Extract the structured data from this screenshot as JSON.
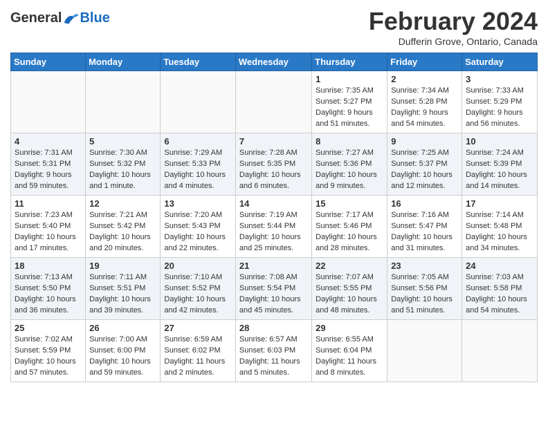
{
  "logo": {
    "general": "General",
    "blue": "Blue",
    "tagline": ""
  },
  "header": {
    "title": "February 2024",
    "subtitle": "Dufferin Grove, Ontario, Canada"
  },
  "days_of_week": [
    "Sunday",
    "Monday",
    "Tuesday",
    "Wednesday",
    "Thursday",
    "Friday",
    "Saturday"
  ],
  "weeks": [
    {
      "shaded": false,
      "days": [
        {
          "date": "",
          "info": ""
        },
        {
          "date": "",
          "info": ""
        },
        {
          "date": "",
          "info": ""
        },
        {
          "date": "",
          "info": ""
        },
        {
          "date": "1",
          "info": "Sunrise: 7:35 AM\nSunset: 5:27 PM\nDaylight: 9 hours and 51 minutes."
        },
        {
          "date": "2",
          "info": "Sunrise: 7:34 AM\nSunset: 5:28 PM\nDaylight: 9 hours and 54 minutes."
        },
        {
          "date": "3",
          "info": "Sunrise: 7:33 AM\nSunset: 5:29 PM\nDaylight: 9 hours and 56 minutes."
        }
      ]
    },
    {
      "shaded": true,
      "days": [
        {
          "date": "4",
          "info": "Sunrise: 7:31 AM\nSunset: 5:31 PM\nDaylight: 9 hours and 59 minutes."
        },
        {
          "date": "5",
          "info": "Sunrise: 7:30 AM\nSunset: 5:32 PM\nDaylight: 10 hours and 1 minute."
        },
        {
          "date": "6",
          "info": "Sunrise: 7:29 AM\nSunset: 5:33 PM\nDaylight: 10 hours and 4 minutes."
        },
        {
          "date": "7",
          "info": "Sunrise: 7:28 AM\nSunset: 5:35 PM\nDaylight: 10 hours and 6 minutes."
        },
        {
          "date": "8",
          "info": "Sunrise: 7:27 AM\nSunset: 5:36 PM\nDaylight: 10 hours and 9 minutes."
        },
        {
          "date": "9",
          "info": "Sunrise: 7:25 AM\nSunset: 5:37 PM\nDaylight: 10 hours and 12 minutes."
        },
        {
          "date": "10",
          "info": "Sunrise: 7:24 AM\nSunset: 5:39 PM\nDaylight: 10 hours and 14 minutes."
        }
      ]
    },
    {
      "shaded": false,
      "days": [
        {
          "date": "11",
          "info": "Sunrise: 7:23 AM\nSunset: 5:40 PM\nDaylight: 10 hours and 17 minutes."
        },
        {
          "date": "12",
          "info": "Sunrise: 7:21 AM\nSunset: 5:42 PM\nDaylight: 10 hours and 20 minutes."
        },
        {
          "date": "13",
          "info": "Sunrise: 7:20 AM\nSunset: 5:43 PM\nDaylight: 10 hours and 22 minutes."
        },
        {
          "date": "14",
          "info": "Sunrise: 7:19 AM\nSunset: 5:44 PM\nDaylight: 10 hours and 25 minutes."
        },
        {
          "date": "15",
          "info": "Sunrise: 7:17 AM\nSunset: 5:46 PM\nDaylight: 10 hours and 28 minutes."
        },
        {
          "date": "16",
          "info": "Sunrise: 7:16 AM\nSunset: 5:47 PM\nDaylight: 10 hours and 31 minutes."
        },
        {
          "date": "17",
          "info": "Sunrise: 7:14 AM\nSunset: 5:48 PM\nDaylight: 10 hours and 34 minutes."
        }
      ]
    },
    {
      "shaded": true,
      "days": [
        {
          "date": "18",
          "info": "Sunrise: 7:13 AM\nSunset: 5:50 PM\nDaylight: 10 hours and 36 minutes."
        },
        {
          "date": "19",
          "info": "Sunrise: 7:11 AM\nSunset: 5:51 PM\nDaylight: 10 hours and 39 minutes."
        },
        {
          "date": "20",
          "info": "Sunrise: 7:10 AM\nSunset: 5:52 PM\nDaylight: 10 hours and 42 minutes."
        },
        {
          "date": "21",
          "info": "Sunrise: 7:08 AM\nSunset: 5:54 PM\nDaylight: 10 hours and 45 minutes."
        },
        {
          "date": "22",
          "info": "Sunrise: 7:07 AM\nSunset: 5:55 PM\nDaylight: 10 hours and 48 minutes."
        },
        {
          "date": "23",
          "info": "Sunrise: 7:05 AM\nSunset: 5:56 PM\nDaylight: 10 hours and 51 minutes."
        },
        {
          "date": "24",
          "info": "Sunrise: 7:03 AM\nSunset: 5:58 PM\nDaylight: 10 hours and 54 minutes."
        }
      ]
    },
    {
      "shaded": false,
      "days": [
        {
          "date": "25",
          "info": "Sunrise: 7:02 AM\nSunset: 5:59 PM\nDaylight: 10 hours and 57 minutes."
        },
        {
          "date": "26",
          "info": "Sunrise: 7:00 AM\nSunset: 6:00 PM\nDaylight: 10 hours and 59 minutes."
        },
        {
          "date": "27",
          "info": "Sunrise: 6:59 AM\nSunset: 6:02 PM\nDaylight: 11 hours and 2 minutes."
        },
        {
          "date": "28",
          "info": "Sunrise: 6:57 AM\nSunset: 6:03 PM\nDaylight: 11 hours and 5 minutes."
        },
        {
          "date": "29",
          "info": "Sunrise: 6:55 AM\nSunset: 6:04 PM\nDaylight: 11 hours and 8 minutes."
        },
        {
          "date": "",
          "info": ""
        },
        {
          "date": "",
          "info": ""
        }
      ]
    }
  ]
}
